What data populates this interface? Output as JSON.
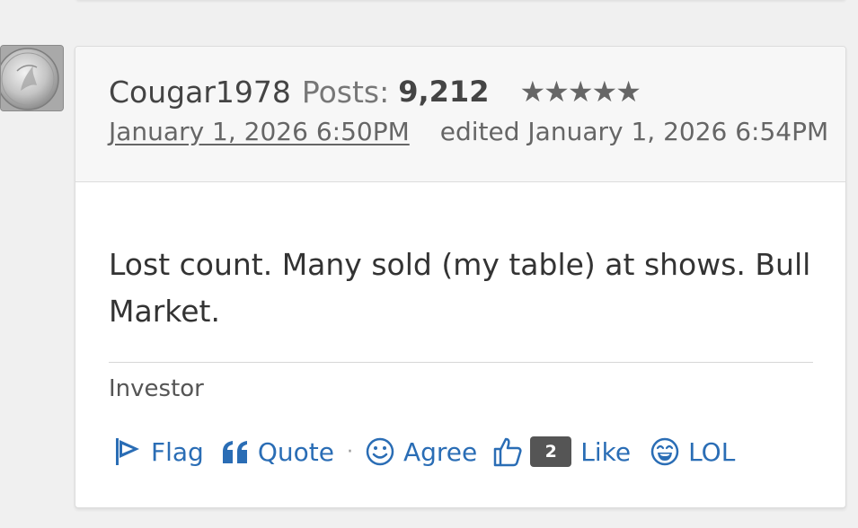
{
  "post": {
    "username": "Cougar1978",
    "posts_label": "Posts:",
    "posts_count": "9,212",
    "stars": "★★★★★",
    "date": "January 1, 2026 6:50PM",
    "edited": "edited January 1, 2026 6:54PM",
    "message": "Lost count. Many sold (my table) at shows. Bull Market.",
    "signature": "Investor"
  },
  "actions": {
    "flag": "Flag",
    "quote": "Quote",
    "separator": "·",
    "agree": "Agree",
    "like_count": "2",
    "like": "Like",
    "lol": "LOL"
  },
  "icons": {
    "flag": "flag-icon",
    "quote": "quote-icon",
    "agree": "smiley-icon",
    "like": "thumbs-up-icon",
    "lol": "laughing-face-icon"
  },
  "colors": {
    "link": "#2a6db5",
    "badge": "#555555",
    "header_bg": "#f7f7f7",
    "page_bg": "#f0f0f0"
  }
}
